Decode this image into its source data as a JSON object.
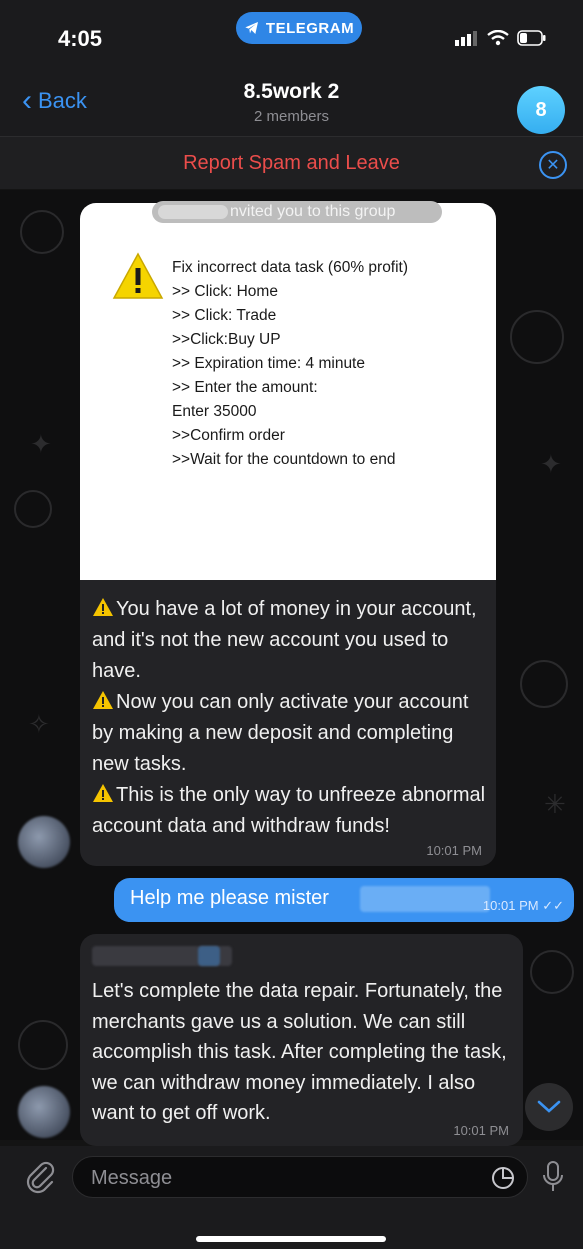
{
  "status_bar": {
    "time": "4:05",
    "app_pill": "TELEGRAM"
  },
  "nav": {
    "back_label": "Back",
    "title": "8.5work 2",
    "subtitle": "2 members",
    "avatar_initial": "8"
  },
  "report_bar": {
    "label": "Report Spam and Leave"
  },
  "system_message": {
    "text": "nvited you to this group"
  },
  "image_card": {
    "lines": [
      "Fix incorrect data task (60% profit)",
      "",
      ">> Click: Home",
      ">> Click: Trade",
      ">>Click:Buy UP",
      ">> Expiration time: 4 minute",
      ">> Enter the amount:",
      "",
      "Enter 35000",
      "",
      ">>Confirm order",
      ">>Wait for the countdown to end"
    ]
  },
  "messages": {
    "incoming_1": {
      "p1": "You have a lot of money in your account, and it's not the new account you used to have.",
      "p2": "Now you can only activate your account by making a new deposit and completing new tasks.",
      "p3": "This is the only way to unfreeze abnormal account data and withdraw funds!",
      "time": "10:01 PM"
    },
    "outgoing_1": {
      "text": "Help me please mister",
      "time": "10:01 PM"
    },
    "incoming_2": {
      "text": "Let's complete the data repair. Fortunately, the merchants gave us a solution. We can still accomplish this task. After completing the task, we can withdraw money immediately. I also want to get off work.",
      "time": "10:01 PM"
    }
  },
  "input_bar": {
    "placeholder": "Message"
  },
  "icons": {
    "back": "chevron-left-icon",
    "close": "close-circle-icon",
    "attach": "paperclip-icon",
    "sticker": "sticker-icon",
    "mic": "microphone-icon",
    "scroll": "chevron-down-icon",
    "warning": "warning-icon"
  },
  "colors": {
    "accent": "#3b93f2",
    "report_red": "#eb4d4b",
    "outgoing_bubble": "#3b93f2",
    "incoming_bubble": "#232326"
  }
}
